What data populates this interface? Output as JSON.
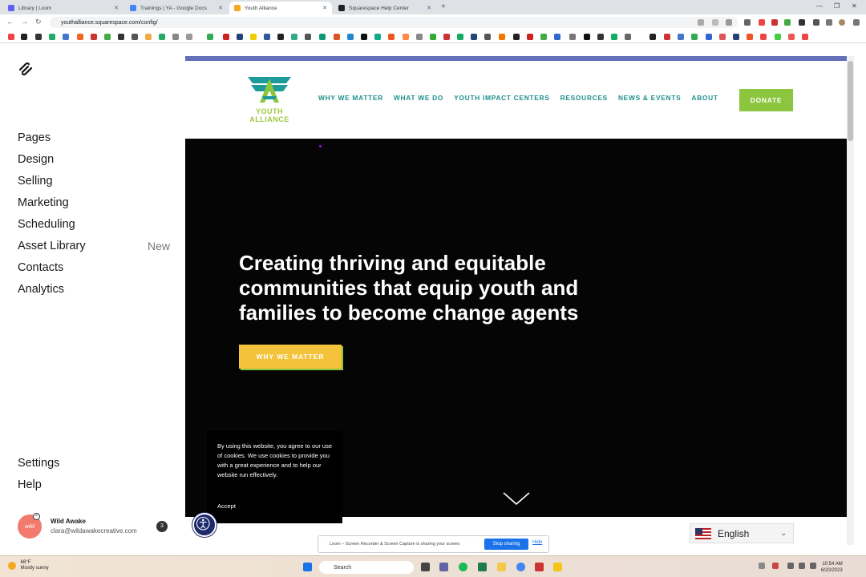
{
  "browser": {
    "tabs": [
      {
        "label": "Library | Loom",
        "active": false,
        "color": "#625df5"
      },
      {
        "label": "Trainings | YA - Google Docs",
        "active": false,
        "color": "#4285f4"
      },
      {
        "label": "Youth Alliance",
        "active": true,
        "color": "#f5a623"
      },
      {
        "label": "Squarespace Help Center",
        "active": false,
        "color": "#222222"
      }
    ],
    "url": "youthalliance.squarespace.com/config/"
  },
  "squarespace": {
    "nav": [
      {
        "label": "Pages",
        "badge": ""
      },
      {
        "label": "Design",
        "badge": ""
      },
      {
        "label": "Selling",
        "badge": ""
      },
      {
        "label": "Marketing",
        "badge": ""
      },
      {
        "label": "Scheduling",
        "badge": ""
      },
      {
        "label": "Asset Library",
        "badge": "New"
      },
      {
        "label": "Contacts",
        "badge": ""
      },
      {
        "label": "Analytics",
        "badge": ""
      }
    ],
    "bottom_nav": [
      {
        "label": "Settings"
      },
      {
        "label": "Help"
      }
    ],
    "user": {
      "name": "Wild Awake",
      "email": "clara@wildawakecreative.com",
      "notifications": "3",
      "avatar_text": "wild"
    }
  },
  "site": {
    "logo_line1": "YOUTH",
    "logo_line2": "ALLIANCE",
    "nav": [
      "WHY WE MATTER",
      "WHAT WE DO",
      "YOUTH IMPACT CENTERS",
      "RESOURCES",
      "NEWS & EVENTS",
      "ABOUT"
    ],
    "donate_label": "DONATE",
    "hero_title": "Creating thriving and equitable communities that equip youth and families to become change agents",
    "hero_cta": "WHY WE MATTER",
    "cookie_text": "By using this website, you agree to our use of cookies. We use cookies to provide you with a great experience and to help our website run effectively.",
    "cookie_accept": "Accept",
    "language": "English",
    "colors": {
      "teal": "#1d8f8b",
      "green": "#8cc63f",
      "yellow": "#f5c33b",
      "topbar": "#6470b8"
    }
  },
  "loom": {
    "message": "Loom – Screen Recorder & Screen Capture is sharing your screen.",
    "stop_label": "Stop sharing",
    "hide_label": "Hide"
  },
  "taskbar": {
    "temperature": "68°F",
    "weather": "Mostly sunny",
    "search_placeholder": "Search",
    "time": "10:54 AM",
    "date": "6/20/2023"
  }
}
